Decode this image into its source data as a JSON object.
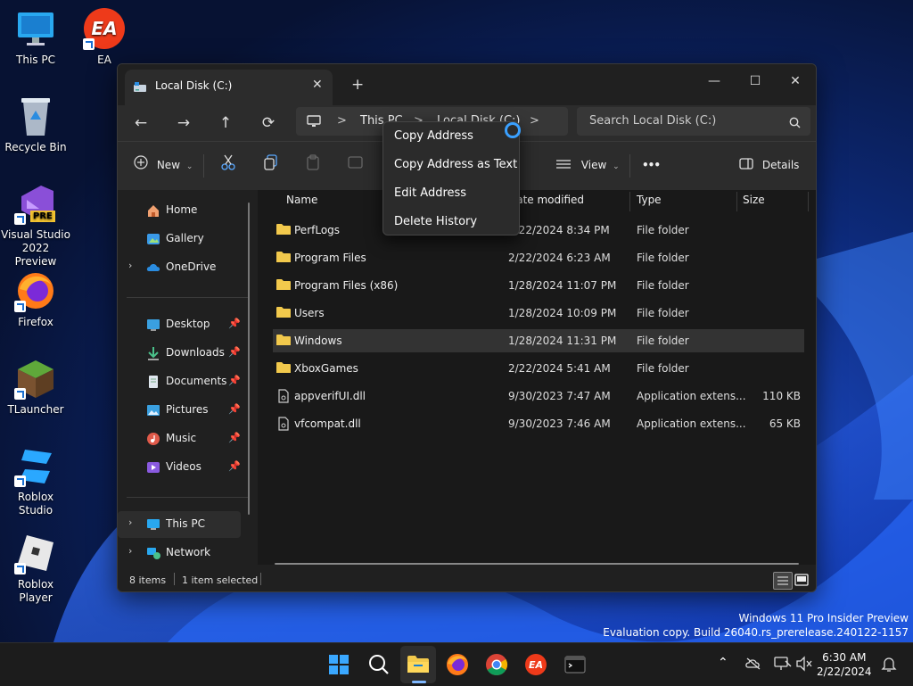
{
  "desktop": {
    "icons": [
      {
        "label": "This PC"
      },
      {
        "label": "EA"
      },
      {
        "label": "Recycle Bin"
      },
      {
        "label": "Visual Studio 2022 Preview",
        "badge": "PRE"
      },
      {
        "label": "Firefox"
      },
      {
        "label": "TLauncher"
      },
      {
        "label": "Roblox Studio"
      },
      {
        "label": "Roblox Player"
      }
    ]
  },
  "window": {
    "tab_title": "Local Disk (C:)",
    "tab_close": "✕",
    "new_tab": "+",
    "controls": {
      "minimize": "—",
      "maximize": "☐",
      "close": "✕"
    },
    "nav": {
      "back": "←",
      "forward": "→",
      "up": "↑",
      "refresh": "⟳"
    },
    "breadcrumb": [
      "This PC",
      "Local Disk (C:)"
    ],
    "breadcrumb_sep": ">",
    "search_placeholder": "Search Local Disk (C:)",
    "toolbar": {
      "new_label": "New",
      "view_label": "View",
      "more_label": "•••",
      "details_label": "Details"
    },
    "nav_pane": {
      "items": [
        {
          "label": "Home"
        },
        {
          "label": "Gallery"
        },
        {
          "label": "OneDrive"
        },
        {
          "label": "Desktop"
        },
        {
          "label": "Downloads"
        },
        {
          "label": "Documents"
        },
        {
          "label": "Pictures"
        },
        {
          "label": "Music"
        },
        {
          "label": "Videos"
        },
        {
          "label": "This PC"
        },
        {
          "label": "Network"
        }
      ]
    },
    "columns": {
      "name": "Name",
      "date": "Date modified",
      "type": "Type",
      "size": "Size"
    },
    "files": [
      {
        "name": "PerfLogs",
        "date": "2/22/2024 8:34 PM",
        "type": "File folder",
        "size": ""
      },
      {
        "name": "Program Files",
        "date": "2/22/2024 6:23 AM",
        "type": "File folder",
        "size": ""
      },
      {
        "name": "Program Files (x86)",
        "date": "1/28/2024 11:07 PM",
        "type": "File folder",
        "size": ""
      },
      {
        "name": "Users",
        "date": "1/28/2024 10:09 PM",
        "type": "File folder",
        "size": ""
      },
      {
        "name": "Windows",
        "date": "1/28/2024 11:31 PM",
        "type": "File folder",
        "size": ""
      },
      {
        "name": "XboxGames",
        "date": "2/22/2024 5:41 AM",
        "type": "File folder",
        "size": ""
      },
      {
        "name": "appverifUI.dll",
        "date": "9/30/2023 7:47 AM",
        "type": "Application extens...",
        "size": "110 KB"
      },
      {
        "name": "vfcompat.dll",
        "date": "9/30/2023 7:46 AM",
        "type": "Application extens...",
        "size": "65 KB"
      }
    ],
    "status": {
      "count": "8 items",
      "selected": "1 item selected"
    }
  },
  "context_menu": {
    "items": [
      "Copy Address",
      "Copy Address as Text",
      "Edit Address",
      "Delete History"
    ]
  },
  "watermark": {
    "line1": "Windows 11 Pro Insider Preview",
    "line2": "Evaluation copy. Build 26040.rs_prerelease.240122-1157"
  },
  "taskbar": {
    "time": "6:30 AM",
    "date": "2/22/2024"
  },
  "colors": {
    "accent": "#3aa0ff",
    "folder": "#f2c94c",
    "window_bg": "#202020"
  }
}
